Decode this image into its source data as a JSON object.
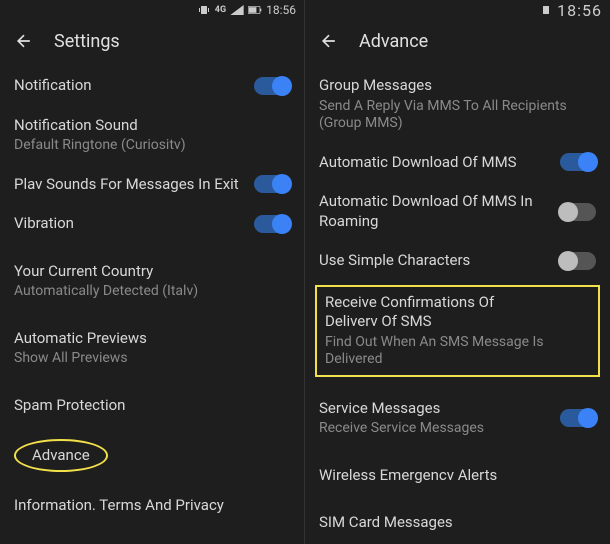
{
  "left": {
    "status_time": "18:56",
    "status_4g": "4G",
    "title": "Settings",
    "rows": {
      "notification": "Notification",
      "notif_sound": "Notification Sound",
      "notif_sound_sub": "Default Ringtone (Curiositv)",
      "play_sounds": "Plav Sounds For Messages In Exit",
      "vibration": "Vibration",
      "country": "Your Current Country",
      "country_sub": "Automatically Detected (Italv)",
      "auto_previews": "Automatic Previews",
      "auto_previews_sub": "Show All Previews",
      "spam": "Spam Protection",
      "advance": "Advance",
      "info": "Information. Terms And Privacy"
    }
  },
  "right": {
    "status_time": "18:56",
    "title": "Advance",
    "rows": {
      "group_msg": "Group Messages",
      "group_msg_sub": "Send A Reply Via MMS To All Recipients (Group MMS)",
      "auto_dl_mms": "Automatic Download Of MMS",
      "auto_dl_roaming": "Automatic Download Of MMS In Roaming",
      "simple_chars": "Use Simple Characters",
      "receive_conf": "Receive Confirmations Of Deliverv Of SMS",
      "receive_conf_sub": "Find Out When An SMS Message Is Delivered",
      "service_msg": "Service Messages",
      "service_msg_sub": "Receive Service Messages",
      "wireless_alerts": "Wireless Emergencv Alerts",
      "sim_card": "SIM Card Messages"
    }
  }
}
